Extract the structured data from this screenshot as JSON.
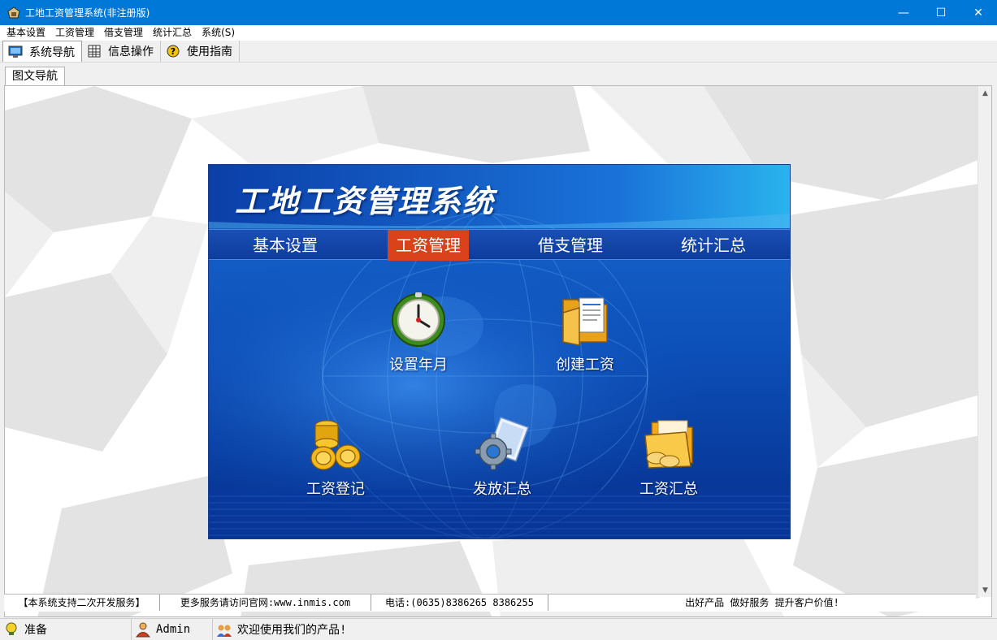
{
  "window": {
    "title": "工地工资管理系统(非注册版)",
    "minimize": "—",
    "maximize": "☐",
    "close": "✕"
  },
  "menu": [
    "基本设置",
    "工资管理",
    "借支管理",
    "统计汇总",
    "系统(S)"
  ],
  "toolbar": {
    "tabs": [
      {
        "label": "系统导航",
        "icon": "monitor-icon"
      },
      {
        "label": "信息操作",
        "icon": "grid-icon"
      },
      {
        "label": "使用指南",
        "icon": "help-icon"
      }
    ],
    "active_tab": "系统导航"
  },
  "document_tab": "图文导航",
  "panel": {
    "title": "工地工资管理系统",
    "nav": [
      "基本设置",
      "工资管理",
      "借支管理",
      "统计汇总"
    ],
    "nav_active": "工资管理",
    "functions": [
      {
        "label": "设置年月",
        "icon": "clock-icon"
      },
      {
        "label": "创建工资",
        "icon": "folder-document-icon"
      },
      {
        "label": "工资登记",
        "icon": "coins-icon"
      },
      {
        "label": "发放汇总",
        "icon": "gear-document-icon"
      },
      {
        "label": "工资汇总",
        "icon": "folder-coins-icon"
      }
    ]
  },
  "infoline": [
    "【本系统支持二次开发服务】",
    "更多服务请访问官网:www.inmis.com",
    "电话:(0635)8386265 8386255",
    "出好产品 做好服务 提升客户价值!"
  ],
  "status": {
    "state": "准备",
    "user": "Admin",
    "message": "欢迎使用我们的产品!"
  },
  "colors": {
    "titlebar": "#0078d7",
    "panel_blue": "#0b47b8",
    "nav_active": "#d9421a"
  }
}
